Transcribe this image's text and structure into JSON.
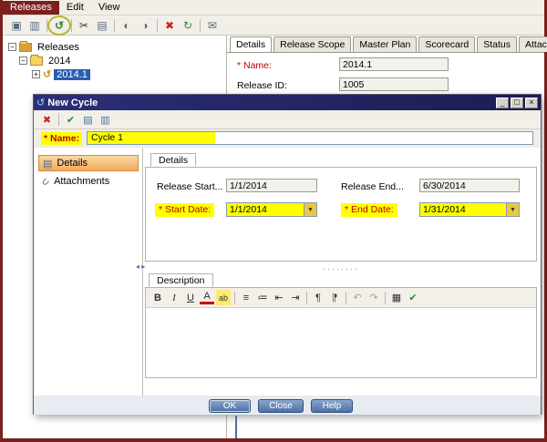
{
  "glyphs": {
    "dropdown": "▼",
    "collapse": "−",
    "expand": "+",
    "splitter_dots": "········",
    "splitter_handle": "◂ ▸",
    "attachment": "∪",
    "details_item": "▤",
    "dialog_title_icon": "↺",
    "release_icon": "↺"
  },
  "colors": {
    "frame_maroon": "#7b1f1f",
    "annotation_yellow": "#b5b52c",
    "highlight_yellow": "#ffff00",
    "titlebar_blue_1": "#2c2e79",
    "titlebar_blue_2": "#1b1d52",
    "button_blue_1": "#8aa6cc",
    "button_blue_2": "#4f6fa3",
    "sidebar_selected_orange": "#f3ab5e",
    "tree_selection_blue": "#2a5db0"
  },
  "window": {
    "menu": {
      "items": [
        "Releases",
        "Edit",
        "View"
      ]
    },
    "toolbar": {
      "icons": [
        {
          "name": "new-release-folder",
          "glyph": "▣"
        },
        {
          "name": "new-release",
          "glyph": "▥"
        },
        {
          "name": "new-cycle",
          "glyph": "↺"
        },
        {
          "name": "cut",
          "glyph": "✂"
        },
        {
          "name": "paste",
          "glyph": "▤"
        },
        {
          "name": "start-timer",
          "glyph": "◐"
        },
        {
          "name": "stop-timer",
          "glyph": "◑"
        },
        {
          "name": "delete",
          "glyph": "✖"
        },
        {
          "name": "refresh",
          "glyph": "↻"
        },
        {
          "name": "send-by-email",
          "glyph": "✉"
        }
      ]
    },
    "tree": {
      "root": "Releases",
      "folder": "2014",
      "release": "2014.1"
    },
    "tabs": [
      "Details",
      "Release Scope",
      "Master Plan",
      "Scorecard",
      "Status",
      "Attachments"
    ],
    "details": {
      "name_label": "* Name:",
      "name_value": "2014.1",
      "release_id_label": "Release ID:",
      "release_id_value": "1005"
    }
  },
  "dialog": {
    "title": "New Cycle",
    "window_buttons": {
      "minimize": "_",
      "maximize": "□",
      "close": "×"
    },
    "toolbar": {
      "icons": [
        {
          "name": "clear",
          "glyph": "✖"
        },
        {
          "name": "spelling",
          "glyph": "✔"
        },
        {
          "name": "spelling-options",
          "glyph": "▤"
        },
        {
          "name": "thesaurus",
          "glyph": "▥"
        }
      ]
    },
    "name_label": "* Name:",
    "name_value": "Cycle 1",
    "sidebar": [
      "Details",
      "Attachments"
    ],
    "tab": "Details",
    "form": {
      "release_start_label": "Release  Start...",
      "release_start_value": "1/1/2014",
      "release_end_label": "Release  End...",
      "release_end_value": "6/30/2014",
      "start_date_label": "* Start Date:",
      "start_date_value": "1/1/2014",
      "end_date_label": "* End Date:",
      "end_date_value": "1/31/2014"
    },
    "description": {
      "tab": "Description",
      "toolbar": [
        {
          "name": "bold",
          "glyph": "B"
        },
        {
          "name": "italic",
          "glyph": "I"
        },
        {
          "name": "underline",
          "glyph": "U"
        },
        {
          "name": "font-color",
          "glyph": "A"
        },
        {
          "name": "highlight",
          "glyph": "ab"
        },
        {
          "name": "bullet-list",
          "glyph": "≡"
        },
        {
          "name": "numbered-list",
          "glyph": "≔"
        },
        {
          "name": "outdent",
          "glyph": "⇤"
        },
        {
          "name": "indent",
          "glyph": "⇥"
        },
        {
          "name": "paragraph-ltr",
          "glyph": "¶"
        },
        {
          "name": "paragraph-rtl",
          "glyph": "¶"
        },
        {
          "name": "undo",
          "glyph": "↶"
        },
        {
          "name": "redo",
          "glyph": "↷"
        },
        {
          "name": "insert-table",
          "glyph": "▦"
        },
        {
          "name": "spell-check",
          "glyph": "✔"
        }
      ]
    },
    "buttons": [
      "OK",
      "Close",
      "Help"
    ]
  }
}
